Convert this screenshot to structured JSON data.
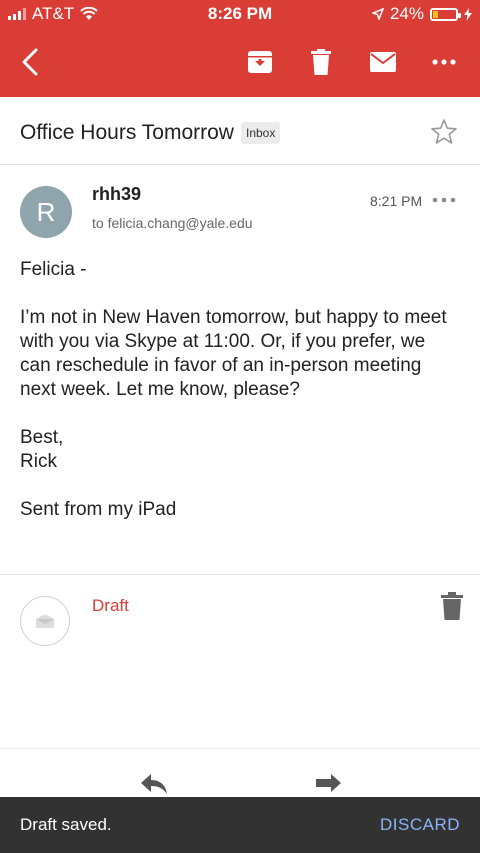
{
  "status": {
    "carrier": "AT&T",
    "time": "8:26 PM",
    "battery": "24%",
    "battery_level": 0.24
  },
  "toolbar": {
    "icons": [
      "back-icon",
      "archive-icon",
      "trash-icon",
      "mail-icon",
      "more-icon"
    ]
  },
  "email": {
    "subject": "Office Hours Tomorrow",
    "label": "Inbox",
    "avatar_initial": "R",
    "sender": "rhh39",
    "to": "to felicia.chang@yale.edu",
    "time": "8:21 PM",
    "body": {
      "greeting": "Felicia -",
      "paragraph": "I’m not in New Haven tomorrow, but happy to meet with you via Skype at 11:00.  Or, if you prefer, we can reschedule in favor of an in-person meeting next week.  Let me know, please?",
      "closing": "Best,",
      "signature": "Rick",
      "footer": "Sent from my iPad"
    }
  },
  "draft": {
    "label": "Draft"
  },
  "snackbar": {
    "message": "Draft saved.",
    "action": "DISCARD"
  },
  "colors": {
    "brand": "#d93d36",
    "snackbar": "#323232",
    "action": "#8ab4f8"
  }
}
